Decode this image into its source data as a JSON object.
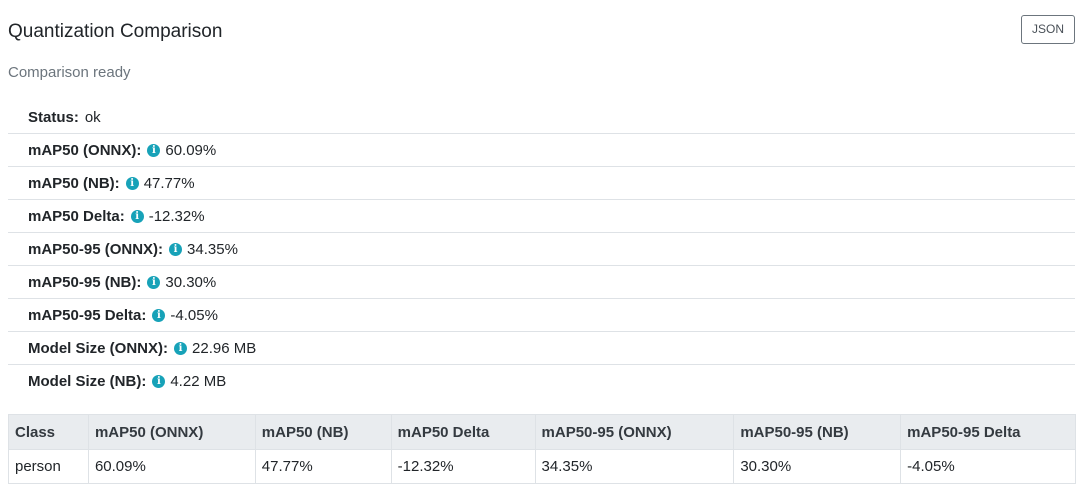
{
  "header": {
    "title": "Quantization Comparison",
    "json_button_label": "JSON"
  },
  "status_message": "Comparison ready",
  "colors": {
    "info_icon": "#17a2b8",
    "table_header_bg": "#e9ecef",
    "muted_text": "#6c757d",
    "border": "#dee2e6"
  },
  "summary": {
    "status": {
      "label": "Status:",
      "value": "ok"
    },
    "metrics": [
      {
        "label": "mAP50 (ONNX):",
        "icon": "info-icon",
        "value": "60.09%"
      },
      {
        "label": "mAP50 (NB):",
        "icon": "info-icon",
        "value": "47.77%"
      },
      {
        "label": "mAP50 Delta:",
        "icon": "info-icon",
        "value": "-12.32%"
      },
      {
        "label": "mAP50-95 (ONNX):",
        "icon": "info-icon",
        "value": "34.35%"
      },
      {
        "label": "mAP50-95 (NB):",
        "icon": "info-icon",
        "value": "30.30%"
      },
      {
        "label": "mAP50-95 Delta:",
        "icon": "info-icon",
        "value": "-4.05%"
      },
      {
        "label": "Model Size (ONNX):",
        "icon": "info-icon",
        "value": "22.96 MB"
      },
      {
        "label": "Model Size (NB):",
        "icon": "info-icon",
        "value": "4.22 MB"
      }
    ]
  },
  "class_table": {
    "columns": [
      "Class",
      "mAP50 (ONNX)",
      "mAP50 (NB)",
      "mAP50 Delta",
      "mAP50-95 (ONNX)",
      "mAP50-95 (NB)",
      "mAP50-95 Delta"
    ],
    "rows": [
      [
        "person",
        "60.09%",
        "47.77%",
        "-12.32%",
        "34.35%",
        "30.30%",
        "-4.05%"
      ]
    ]
  }
}
